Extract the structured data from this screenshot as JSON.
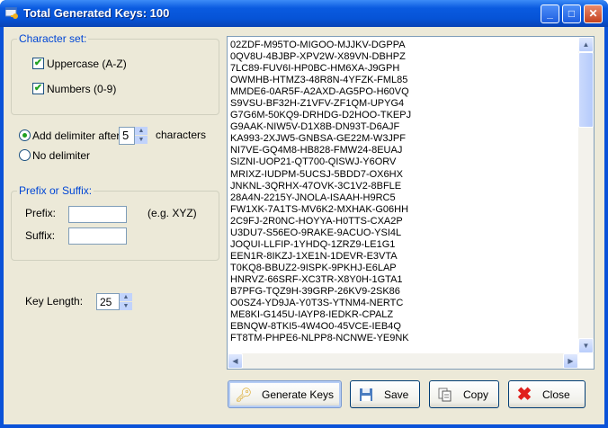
{
  "window": {
    "title": "Total Generated Keys: 100"
  },
  "character_set": {
    "title": "Character set:",
    "uppercase": {
      "label": "Uppercase (A-Z)",
      "checked": true
    },
    "numbers": {
      "label": "Numbers (0-9)",
      "checked": true
    }
  },
  "delimiter": {
    "add_label": "Add delimiter after:",
    "value": "5",
    "unit": "characters",
    "none_label": "No delimiter",
    "selected": "add"
  },
  "prefix_suffix": {
    "title": "Prefix or Suffix:",
    "prefix_label": "Prefix:",
    "prefix_value": "",
    "hint": "(e.g. XYZ)",
    "suffix_label": "Suffix:",
    "suffix_value": ""
  },
  "key_length": {
    "label": "Key Length:",
    "value": "25"
  },
  "keys": [
    "02ZDF-M95TO-MIGOO-MJJKV-DGPPA",
    "0QV8U-4BJBP-XPV2W-X89VN-DBHPZ",
    "7LC89-FUV6I-HP0BC-HM6XA-J9GPH",
    "OWMHB-HTMZ3-48R8N-4YFZK-FML85",
    "MMDE6-0AR5F-A2AXD-AG5PO-H60VQ",
    "S9VSU-BF32H-Z1VFV-ZF1QM-UPYG4",
    "G7G6M-50KQ9-DRHDG-D2HOO-TKEPJ",
    "G9AAK-NIW5V-D1X8B-DN93T-D6AJF",
    "KA993-2XJW5-GNBSA-GE22M-W3JPF",
    "NI7VE-GQ4M8-HB828-FMW24-8EUAJ",
    "SIZNI-UOP21-QT700-QISWJ-Y6ORV",
    "MRIXZ-IUDPM-5UCSJ-5BDD7-OX6HX",
    "JNKNL-3QRHX-47OVK-3C1V2-8BFLE",
    "28A4N-2215Y-JNOLA-ISAAH-H9RC5",
    "FW1XK-7A1TS-MV6K2-MXHAK-G06HH",
    "2C9FJ-2R0NC-HOYYA-H0TTS-CXA2P",
    "U3DU7-S56EO-9RAKE-9ACUO-YSI4L",
    "JOQUI-LLFIP-1YHDQ-1ZRZ9-LE1G1",
    "EEN1R-8IKZJ-1XE1N-1DEVR-E3VTA",
    "T0KQ8-BBUZ2-9ISPK-9PKHJ-E6LAP",
    "HNRVZ-66SRF-XC3TR-X8Y0H-1GTA1",
    "B7PFG-TQZ9H-39GRP-26KV9-2SK86",
    "O0SZ4-YD9JA-Y0T3S-YTNM4-NERTC",
    "ME8KI-G145U-IAYP8-IEDKR-CPALZ",
    "EBNQW-8TKI5-4W4O0-45VCE-IEB4Q",
    "FT8TM-PHPE6-NLPP8-NCNWE-YE9NK"
  ],
  "buttons": {
    "generate": "Generate Keys",
    "save": "Save",
    "copy": "Copy",
    "close": "Close"
  }
}
